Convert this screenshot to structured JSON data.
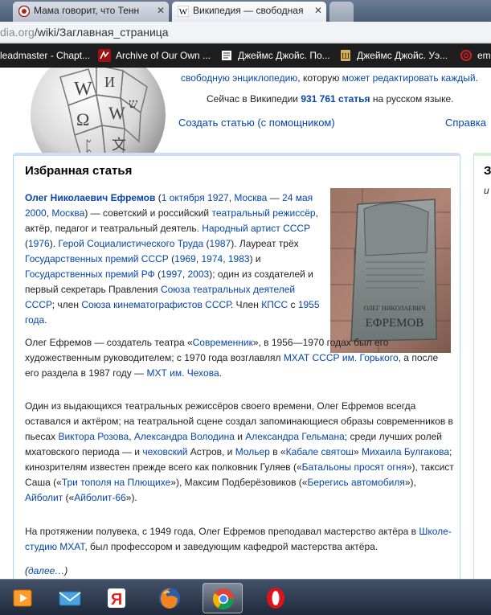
{
  "browser": {
    "tabs": [
      {
        "title": "Мама говорит, что Тенн",
        "active": false
      },
      {
        "title": "Википедия — свободная",
        "active": true
      }
    ],
    "url_dim": "dia.org",
    "url_main": "/wiki/Заглавная_страница",
    "bookmarks": [
      {
        "label": "leadmaster - Chapt...",
        "color": "#c8a24a"
      },
      {
        "label": "Archive of Our Own ...",
        "color": "#a01010"
      },
      {
        "label": "Джеймс Джойс. По...",
        "color": "#ffffff"
      },
      {
        "label": "Джеймс Джойс. Уэ...",
        "color": "#d4b060"
      },
      {
        "label": "em",
        "color": "#cc2222"
      }
    ]
  },
  "header": {
    "intro_link1": "свободную энциклопедию",
    "intro_text1": ", которую ",
    "intro_link2": "может редактировать каждый",
    "intro_text2": ".",
    "count_prefix": "Сейчас в Википедии ",
    "count_link": "931 761 статья",
    "count_suffix": " на русском языке.",
    "create_link": "Создать статью (с помощником)",
    "help_link": "Справка"
  },
  "featured": {
    "title": "Избранная статья",
    "more": "(далее…)",
    "plaque": {
      "line1": "ОЛЕГ НИКОЛАЕВИЧ",
      "line2": "ЕФРЕМОВ"
    }
  },
  "right_col": {
    "heading": "З",
    "italic": "и"
  },
  "taskbar": {
    "apps": [
      "media-player",
      "mail",
      "yandex",
      "firefox",
      "chrome",
      "opera"
    ]
  }
}
